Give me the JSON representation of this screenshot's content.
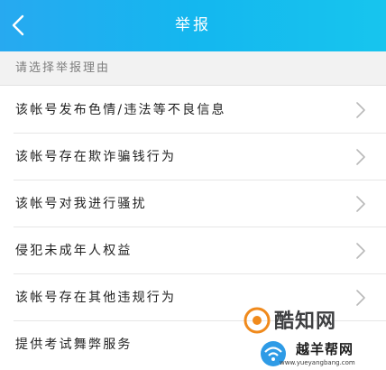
{
  "header": {
    "title": "举报",
    "back_icon": "chevron-left-icon"
  },
  "subheader": {
    "label": "请选择举报理由"
  },
  "reasons": [
    {
      "label": "该帐号发布色情/违法等不良信息"
    },
    {
      "label": "该帐号存在欺诈骗钱行为"
    },
    {
      "label": "该帐号对我进行骚扰"
    },
    {
      "label": "侵犯未成年人权益"
    },
    {
      "label": "该帐号存在其他违规行为"
    },
    {
      "label": "提供考试舞弊服务"
    }
  ],
  "watermark": {
    "logo_text": "酷知网",
    "cn_text": "越羊帮网",
    "url": "www.yueyangbang.com"
  },
  "colors": {
    "header_start": "#27a9f0",
    "header_end": "#17c5ee",
    "row_text": "#222222",
    "subheader_bg": "#f2f2f2"
  }
}
